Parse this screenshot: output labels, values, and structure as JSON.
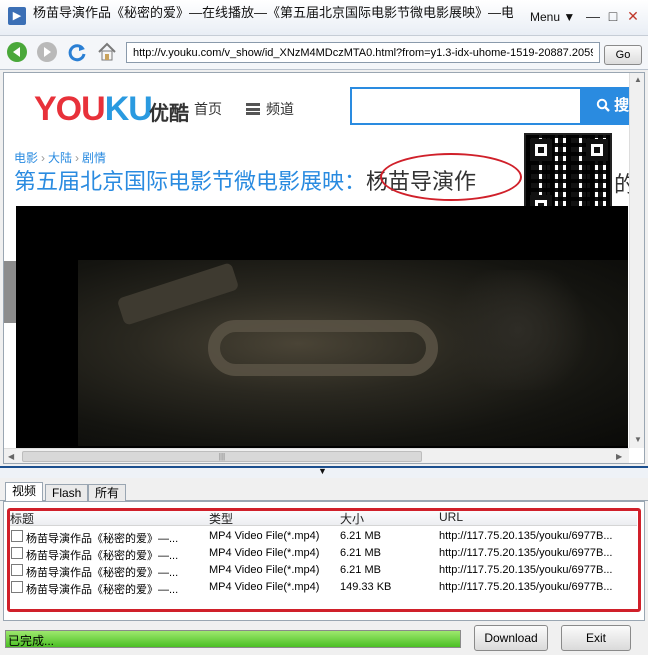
{
  "window": {
    "title": "杨苗导演作品《秘密的爱》—在线播放—《第五届北京国际电影节微电影展映》—电影—优酷网，视频高清在线观看",
    "menu_label": "Menu ▼",
    "minimize_glyph": "—",
    "restore_glyph": "□",
    "close_glyph": "✕"
  },
  "navbar": {
    "url": "http://v.youku.com/v_show/id_XNzM4MDczMTA0.html?from=y1.3-idx-uhome-1519-20887.2059",
    "go_label": "Go",
    "icons": [
      "back-arrow-icon",
      "forward-arrow-icon",
      "refresh-icon",
      "home-icon"
    ]
  },
  "webpage": {
    "logo_you": "YOU",
    "logo_ku": "KU",
    "logo_cn": "优酷",
    "nav_home": "首页",
    "nav_channel": "频道",
    "search_button": "搜",
    "breadcrumb": [
      "电影",
      "大陆",
      "剧情"
    ],
    "breadcrumb_sep": "›",
    "title_main": "第五届北京国际电影节微电影展映：",
    "title_tail": "杨苗导演作",
    "title_overflow": "的",
    "colors": {
      "brand_red": "#e8313a",
      "brand_blue": "#2a9ae0",
      "link_blue": "#2a8be0"
    }
  },
  "scrollbar": {
    "arrow_up": "▲",
    "arrow_down": "▼",
    "arrow_left": "◀",
    "arrow_right": "▶",
    "thumb_grip": "|||"
  },
  "tabs": [
    {
      "label": "视频",
      "active": true
    },
    {
      "label": "Flash",
      "active": false
    },
    {
      "label": "所有",
      "active": false
    }
  ],
  "list": {
    "columns": [
      "标题",
      "类型",
      "大小",
      "URL"
    ],
    "rows": [
      {
        "title": "杨苗导演作品《秘密的爱》—...",
        "type": "MP4 Video File(*.mp4)",
        "size": "6.21 MB",
        "url": "http://117.75.20.135/youku/6977B..."
      },
      {
        "title": "杨苗导演作品《秘密的爱》—...",
        "type": "MP4 Video File(*.mp4)",
        "size": "6.21 MB",
        "url": "http://117.75.20.135/youku/6977B..."
      },
      {
        "title": "杨苗导演作品《秘密的爱》—...",
        "type": "MP4 Video File(*.mp4)",
        "size": "6.21 MB",
        "url": "http://117.75.20.135/youku/6977B..."
      },
      {
        "title": "杨苗导演作品《秘密的爱》—...",
        "type": "MP4 Video File(*.mp4)",
        "size": "149.33 KB",
        "url": "http://117.75.20.135/youku/6977B..."
      }
    ]
  },
  "status": {
    "text": "已完成...",
    "progress": 1.0,
    "download_label": "Download",
    "exit_label": "Exit"
  }
}
